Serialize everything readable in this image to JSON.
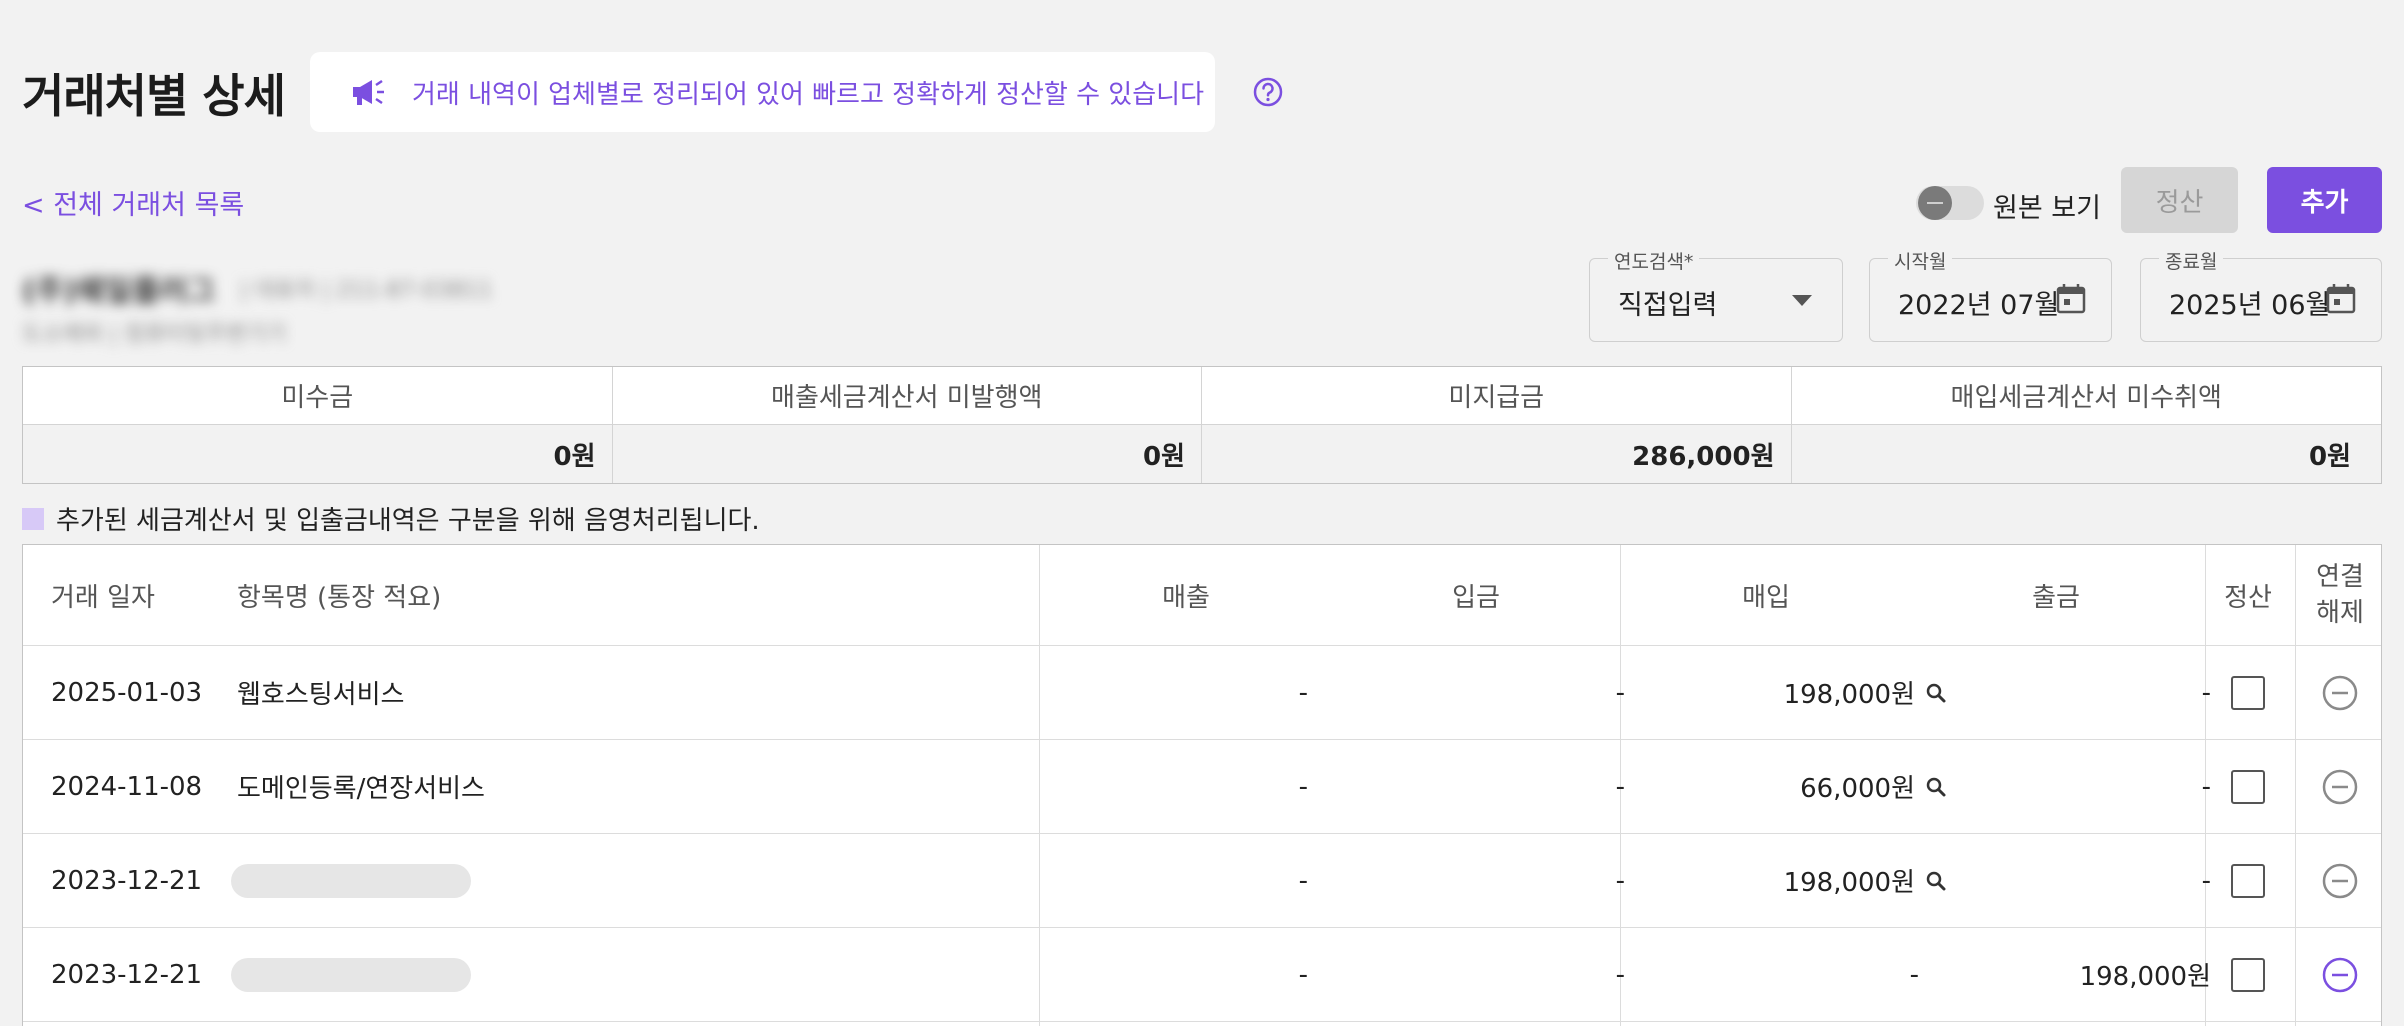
{
  "header": {
    "title": "거래처별 상세",
    "banner_text": "거래 내역이 업체별로 정리되어 있어 빠르고 정확하게 정산할 수 있습니다",
    "back_link": "< 전체 거래처 목록"
  },
  "toolbar": {
    "toggle_label": "원본 보기",
    "settle_label": "정산",
    "add_label": "추가"
  },
  "company": {
    "name": "(주)웨일플러그",
    "meta": "| 대표자 | 211-87-03811",
    "address": "도소매외 | 컴퓨터및주변기기"
  },
  "filters": {
    "year": {
      "label": "연도검색*",
      "value": "직접입력"
    },
    "start": {
      "label": "시작월",
      "value": "2022년 07월"
    },
    "end": {
      "label": "종료월",
      "value": "2025년 06월"
    }
  },
  "summary": {
    "headers": [
      "미수금",
      "매출세금계산서 미발행액",
      "미지급금",
      "매입세금계산서 미수취액"
    ],
    "values": [
      "0원",
      "0원",
      "286,000원",
      "0원"
    ]
  },
  "legend_text": "추가된 세금계산서 및 입출금내역은 구분을 위해 음영처리됩니다.",
  "table": {
    "headers": {
      "date": "거래 일자",
      "item": "항목명 (통장 적요)",
      "sales": "매출",
      "deposit": "입금",
      "purchase": "매입",
      "withdrawal": "출금",
      "settle": "정산",
      "unlink": "연결\n해제"
    },
    "rows": [
      {
        "date": "2025-01-03",
        "item": "웹호스팅서비스",
        "sales": "-",
        "deposit": "-",
        "purchase": "198,000원",
        "withdrawal": "-"
      },
      {
        "date": "2024-11-08",
        "item": "도메인등록/연장서비스",
        "sales": "-",
        "deposit": "-",
        "purchase": "66,000원",
        "withdrawal": "-"
      },
      {
        "date": "2023-12-21",
        "item": "",
        "sales": "-",
        "deposit": "-",
        "purchase": "198,000원",
        "withdrawal": "-"
      },
      {
        "date": "2023-12-21",
        "item": "",
        "sales": "-",
        "deposit": "-",
        "purchase": "-",
        "withdrawal": "198,000원"
      }
    ]
  },
  "colors": {
    "accent": "#7b4fe0",
    "muted_button": "#d6d6d6",
    "legend_swatch": "#d7c9f7"
  },
  "icons": {
    "banner": "megaphone-icon",
    "help": "help-circle-icon",
    "calendar": "calendar-icon",
    "search": "magnifier-icon",
    "unlink": "minus-circle-icon"
  }
}
